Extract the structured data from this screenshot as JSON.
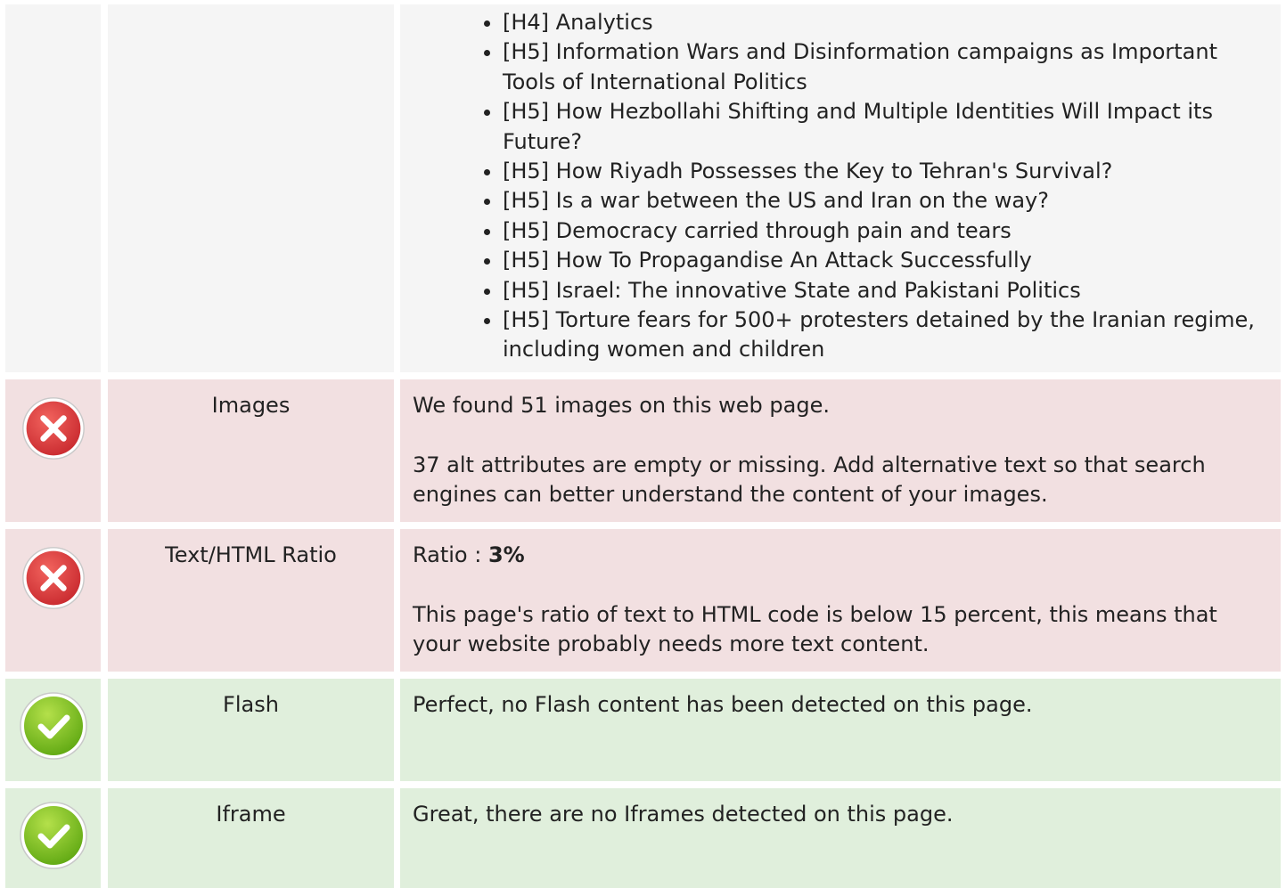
{
  "headings_list": [
    "[H4] Analytics",
    "[H5] Information Wars and Disinformation campaigns as Important Tools of International Politics",
    "[H5] How Hezbollahi Shifting and Multiple Identities Will Impact its Future?",
    "[H5] How Riyadh Possesses the Key to Tehran's Survival?",
    "[H5] Is a war between the US and Iran on the way?",
    "[H5] Democracy carried through pain and tears",
    "[H5] How To Propagandise An Attack Successfully",
    "[H5] Israel: The innovative State and Pakistani Politics",
    "[H5] Torture fears for 500+ protesters detained by the Iranian regime, including women and children"
  ],
  "images": {
    "status": "error",
    "status_icon": "error-x-icon",
    "label": "Images",
    "text_1": "We found 51 images on this web page.",
    "text_2": "37 alt attributes are empty or missing. Add alternative text so that search engines can better understand the content of your images."
  },
  "text_html_ratio": {
    "status": "error",
    "status_icon": "error-x-icon",
    "label": "Text/HTML Ratio",
    "ratio_prefix": "Ratio : ",
    "ratio_value": "3%",
    "text_2": "This page's ratio of text to HTML code is below 15 percent, this means that your website probably needs more text content."
  },
  "flash": {
    "status": "ok",
    "status_icon": "check-icon",
    "label": "Flash",
    "text_1": "Perfect, no Flash content has been detected on this page."
  },
  "iframe": {
    "status": "ok",
    "status_icon": "check-icon",
    "label": "Iframe",
    "text_1": "Great, there are no Iframes detected on this page."
  },
  "colors": {
    "error_bg": "#f2e0e1",
    "ok_bg": "#e0efdc",
    "neutral_bg": "#f5f5f5",
    "error_icon": "#d9363b",
    "ok_icon": "#7cbf1e"
  }
}
